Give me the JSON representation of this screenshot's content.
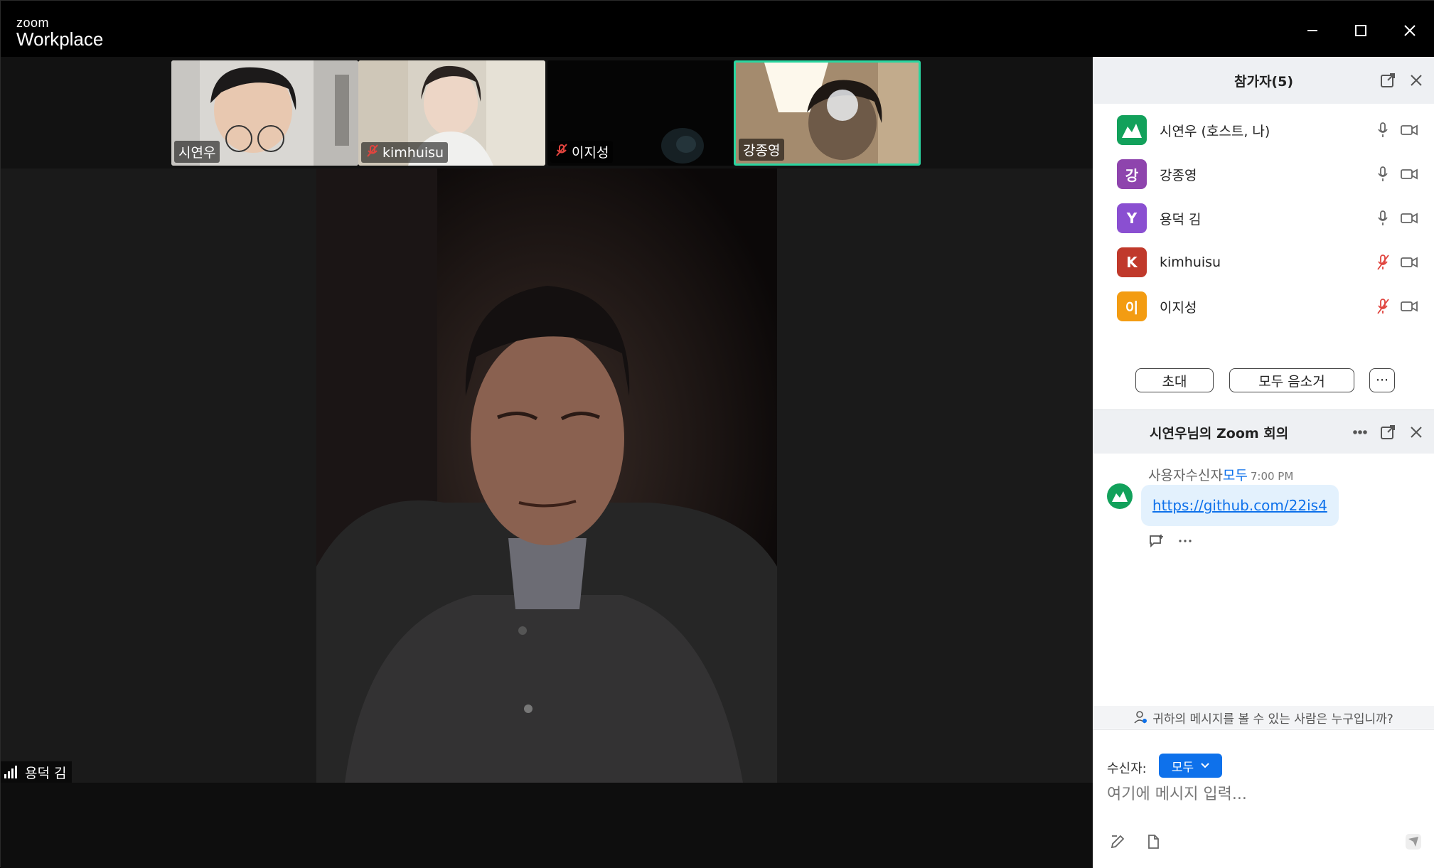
{
  "app": {
    "brand_top": "zoom",
    "brand_bottom": "Workplace"
  },
  "thumbnails": [
    {
      "name": "시연우",
      "muted": false
    },
    {
      "name": "kimhuisu",
      "muted": true
    },
    {
      "name": "이지성",
      "muted": true
    },
    {
      "name": "강종영",
      "muted": false,
      "active": true
    }
  ],
  "main_video": {
    "speaker_name": "용덕 김"
  },
  "participants": {
    "title": "참가자(5)",
    "items": [
      {
        "name": "시연우 (호스트, 나)",
        "initial": "",
        "color": "#12a15b",
        "muted": false
      },
      {
        "name": "강종영",
        "initial": "강",
        "color": "#8e44ad",
        "muted": false
      },
      {
        "name": "용덕 김",
        "initial": "Y",
        "color": "#8a4fd1",
        "muted": false
      },
      {
        "name": "kimhuisu",
        "initial": "K",
        "color": "#c0392b",
        "muted": true
      },
      {
        "name": "이지성",
        "initial": "이",
        "color": "#f39c12",
        "muted": true
      }
    ],
    "invite_label": "초대",
    "mute_all_label": "모두 음소거",
    "more_label": "···"
  },
  "chat": {
    "title": "시연우님의 Zoom 회의",
    "message": {
      "sender_prefix": "사용자수신자",
      "recipient": "모두",
      "time": "7:00 PM",
      "text": "https://github.com/22is4"
    },
    "who_can_see": "귀하의 메시지를 볼 수 있는 사람은 누구입니까?",
    "to_label": "수신자:",
    "to_value": "모두",
    "input_placeholder": "여기에 메시지 입력..."
  }
}
